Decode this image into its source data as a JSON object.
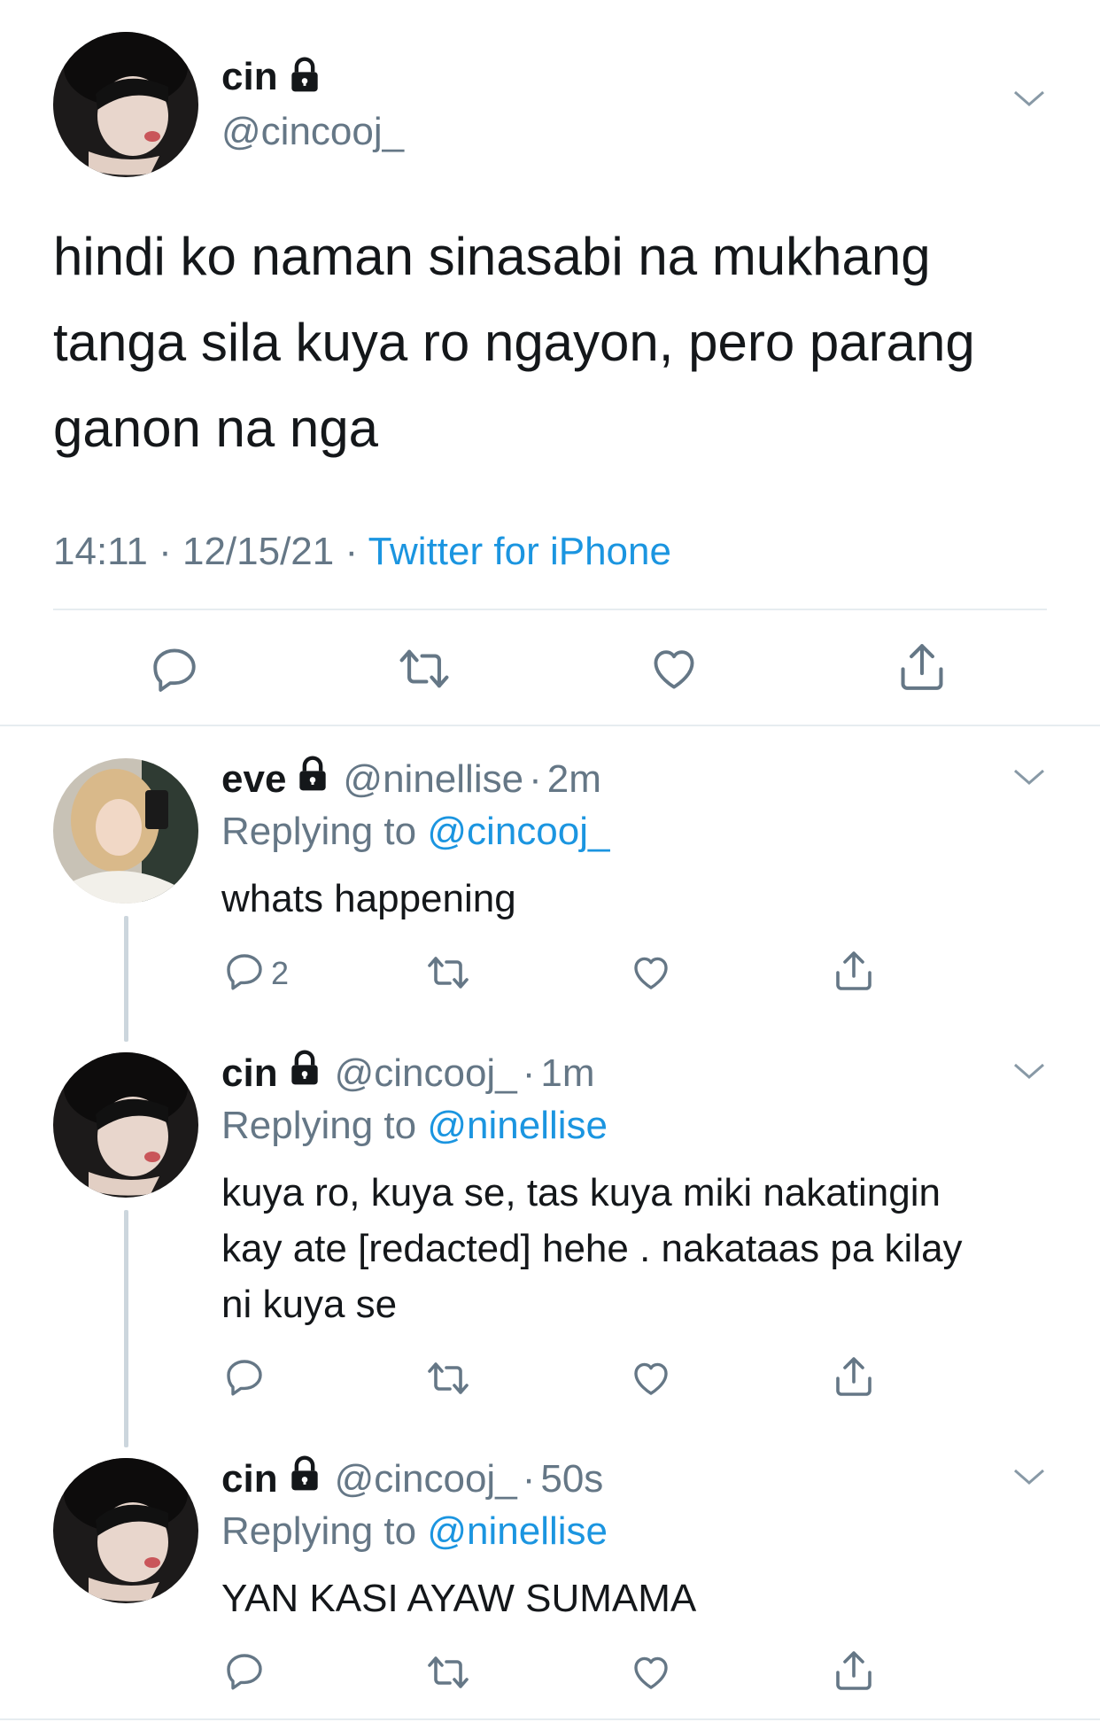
{
  "main_tweet": {
    "name": "cin",
    "handle": "@cincooj_",
    "lines": [
      "hindi ko naman sinasabi na mukhang",
      "tanga sila kuya ro ngayon, pero parang",
      "ganon na nga"
    ],
    "time": "14:11",
    "sep1": "·",
    "date": "12/15/21",
    "sep2": "·",
    "source": "Twitter for iPhone"
  },
  "replies": [
    {
      "name": "eve",
      "handle": "@ninellise",
      "dot": "·",
      "age": "2m",
      "replying_label": "Replying to",
      "replying_to": "@cincooj_",
      "lines": [
        "whats happening"
      ],
      "reply_count": "2"
    },
    {
      "name": "cin",
      "handle": "@cincooj_",
      "dot": "·",
      "age": "1m",
      "replying_label": "Replying to",
      "replying_to": "@ninellise",
      "lines": [
        "kuya ro, kuya se, tas kuya miki nakatingin",
        "kay ate [redacted] hehe . nakataas pa kilay",
        "ni kuya se"
      ],
      "reply_count": ""
    },
    {
      "name": "cin",
      "handle": "@cincooj_",
      "dot": "·",
      "age": "50s",
      "replying_label": "Replying to",
      "replying_to": "@ninellise",
      "lines": [
        "YAN KASI AYAW SUMAMA"
      ],
      "reply_count": ""
    }
  ],
  "icons": {
    "reply": "reply-icon",
    "retweet": "retweet-icon",
    "like": "heart-icon",
    "share": "share-icon",
    "lock": "lock-icon",
    "caret": "chevron-down-icon"
  },
  "colors": {
    "link": "#1b95e0",
    "secondary": "#657786",
    "text": "#14171a",
    "divider": "#e6ecf0"
  }
}
